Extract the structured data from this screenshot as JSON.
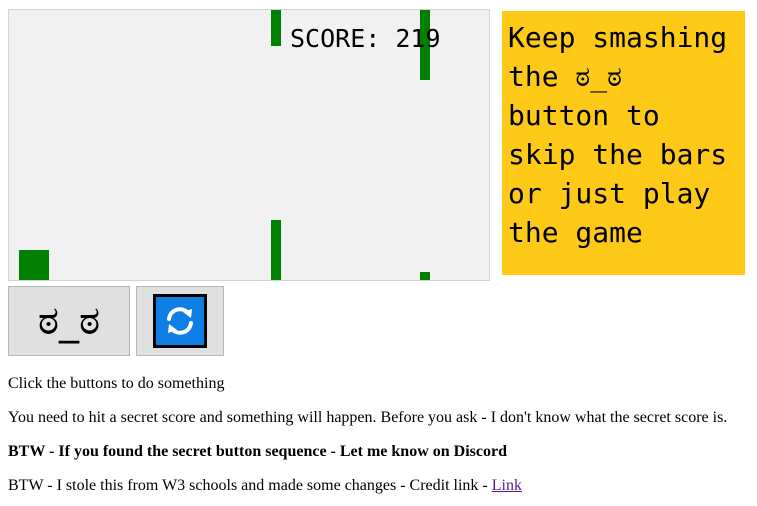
{
  "game": {
    "score_label": "SCORE: 219",
    "bar_color": "#008000",
    "player_color": "#008000",
    "canvas_bg": "#f1f1f1"
  },
  "hint": {
    "text": "Keep smashing the ಠ_ಠ button to skip the bars or just play the game",
    "bg_color": "#ffc918"
  },
  "buttons": {
    "face_label": "ಠ_ಠ",
    "reset_icon": "refresh-icon",
    "reset_color": "#0f7fe6"
  },
  "text": {
    "line1": "Click the buttons to do something",
    "line2": "You need to hit a secret score and something will happen. Before you ask - I don't know what the secret score is.",
    "line3": "BTW - If you found the secret button sequence - Let me know on Discord",
    "line4_prefix": "BTW - I stole this from W3 schools and made some changes - Credit link - ",
    "link_label": "Link"
  }
}
